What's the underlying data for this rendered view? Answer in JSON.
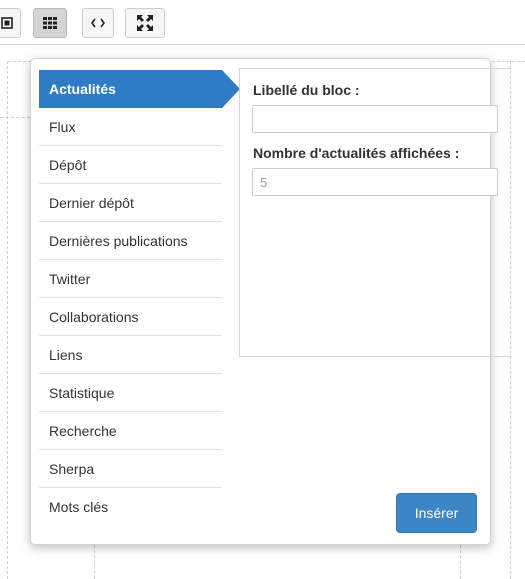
{
  "toolbar": {
    "buttons": [
      {
        "icon": "insert-block-icon"
      },
      {
        "icon": "grid-icon",
        "active": true
      },
      {
        "icon": "code-icon"
      },
      {
        "icon": "fullscreen-icon"
      }
    ]
  },
  "block_menu": {
    "selected": "Actualités",
    "items": [
      {
        "label": "Actualités"
      },
      {
        "label": "Flux"
      },
      {
        "label": "Dépôt"
      },
      {
        "label": "Dernier dépôt"
      },
      {
        "label": "Dernières publications"
      },
      {
        "label": "Twitter"
      },
      {
        "label": "Collaborations"
      },
      {
        "label": "Liens"
      },
      {
        "label": "Statistique"
      },
      {
        "label": "Recherche"
      },
      {
        "label": "Sherpa"
      },
      {
        "label": "Mots clés"
      }
    ]
  },
  "form": {
    "block_label": {
      "label": "Libellé du bloc :",
      "value": ""
    },
    "news_count": {
      "label": "Nombre d'actualités affichées :",
      "value": "5"
    }
  },
  "insert_button": {
    "label": "Insérer"
  },
  "colors": {
    "accent": "#2d7cc4",
    "button": "#3d86c6",
    "text": "#333333"
  }
}
